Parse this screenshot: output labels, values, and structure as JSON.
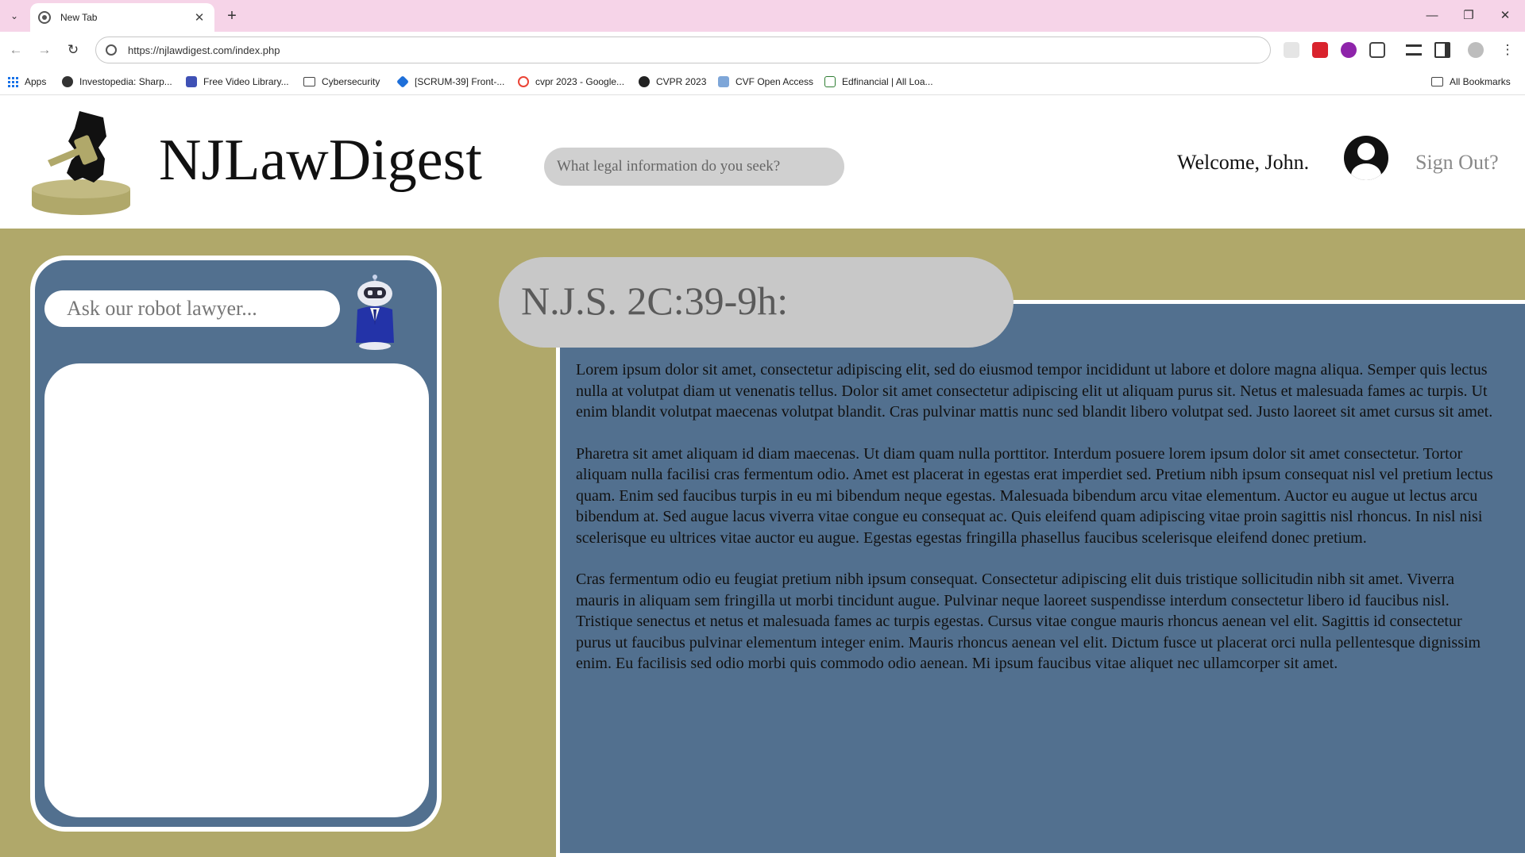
{
  "browser": {
    "tab_title": "New Tab",
    "url": "https://njlawdigest.com/index.php",
    "bookmarks": [
      {
        "label": "Apps",
        "icon": "apps-icon"
      },
      {
        "label": "Investopedia: Sharp...",
        "icon": "investopedia-icon"
      },
      {
        "label": "Free Video Library...",
        "icon": "video-library-icon"
      },
      {
        "label": "Cybersecurity",
        "icon": "folder-icon"
      },
      {
        "label": "[SCRUM-39] Front-...",
        "icon": "jira-icon"
      },
      {
        "label": "cvpr 2023 - Google...",
        "icon": "google-icon"
      },
      {
        "label": "CVPR 2023",
        "icon": "cvpr-icon"
      },
      {
        "label": "CVF Open Access",
        "icon": "cvf-icon"
      },
      {
        "label": "Edfinancial | All Loa...",
        "icon": "edfinancial-icon"
      }
    ],
    "all_bookmarks_label": "All Bookmarks",
    "colors": {
      "tabstrip": "#f6d4e8"
    }
  },
  "site": {
    "title": "NJLawDigest",
    "search_placeholder": "What legal information do you seek?",
    "welcome": "Welcome, John.",
    "signout": "Sign Out?",
    "colors": {
      "background": "#b0a86a",
      "panel": "#52708f",
      "pill": "#c8c8c8"
    }
  },
  "chat": {
    "input_placeholder": "Ask our robot lawyer..."
  },
  "statute": {
    "title": "N.J.S. 2C:39-9h:",
    "paragraphs": [
      "Lorem ipsum dolor sit amet, consectetur adipiscing elit, sed do eiusmod tempor incididunt ut labore et dolore magna aliqua. Semper quis lectus nulla at volutpat diam ut venenatis tellus. Dolor sit amet consectetur adipiscing elit ut aliquam purus sit. Netus et malesuada fames ac turpis. Ut enim blandit volutpat maecenas volutpat blandit. Cras pulvinar mattis nunc sed blandit libero volutpat sed. Justo laoreet sit amet cursus sit amet.",
      "Pharetra sit amet aliquam id diam maecenas. Ut diam quam nulla porttitor. Interdum posuere lorem ipsum dolor sit amet consectetur. Tortor aliquam nulla facilisi cras fermentum odio. Amet est placerat in egestas erat imperdiet sed. Pretium nibh ipsum consequat nisl vel pretium lectus quam. Enim sed faucibus turpis in eu mi bibendum neque egestas. Malesuada bibendum arcu vitae elementum. Auctor eu augue ut lectus arcu bibendum at.  Sed augue lacus viverra vitae congue eu consequat ac. Quis eleifend quam adipiscing vitae proin sagittis nisl rhoncus. In nisl nisi scelerisque eu ultrices vitae auctor eu augue. Egestas egestas fringilla phasellus faucibus scelerisque eleifend donec pretium.",
      "Cras fermentum odio eu feugiat pretium nibh ipsum consequat. Consectetur adipiscing elit duis tristique sollicitudin nibh sit amet. Viverra mauris in aliquam sem fringilla ut morbi tincidunt augue. Pulvinar neque laoreet suspendisse interdum consectetur libero id faucibus nisl. Tristique senectus et netus et malesuada fames ac turpis egestas. Cursus vitae congue mauris rhoncus aenean vel elit. Sagittis id consectetur purus ut faucibus pulvinar elementum integer enim. Mauris rhoncus aenean vel elit. Dictum fusce ut placerat orci nulla pellentesque dignissim enim. Eu facilisis sed odio morbi quis commodo odio aenean. Mi ipsum faucibus vitae aliquet nec ullamcorper sit amet."
    ]
  }
}
